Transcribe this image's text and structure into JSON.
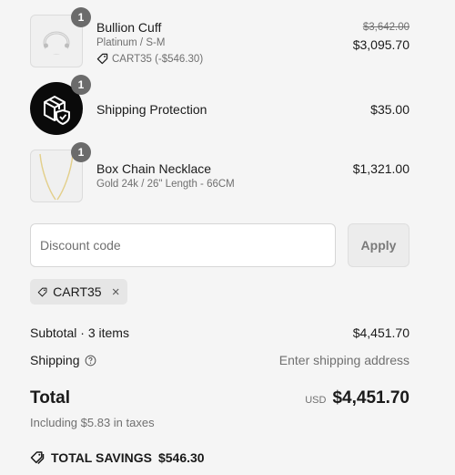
{
  "items": [
    {
      "name": "Bullion Cuff",
      "variant": "Platinum / S-M",
      "discount": "CART35 (-$546.30)",
      "original_price": "$3,642.00",
      "price": "$3,095.70",
      "quantity": "1"
    },
    {
      "name": "Shipping Protection",
      "price": "$35.00",
      "quantity": "1"
    },
    {
      "name": "Box Chain Necklace",
      "variant": "Gold 24k / 26\" Length - 66CM",
      "price": "$1,321.00",
      "quantity": "1"
    }
  ],
  "discount": {
    "placeholder": "Discount code",
    "apply_label": "Apply",
    "applied_code": "CART35"
  },
  "summary": {
    "subtotal_label": "Subtotal · 3 items",
    "subtotal_value": "$4,451.70",
    "shipping_label": "Shipping",
    "shipping_value": "Enter shipping address",
    "total_label": "Total",
    "total_currency": "USD",
    "total_value": "$4,451.70",
    "taxes_note": "Including $5.83 in taxes",
    "savings_label": "TOTAL SAVINGS",
    "savings_value": "$546.30"
  }
}
